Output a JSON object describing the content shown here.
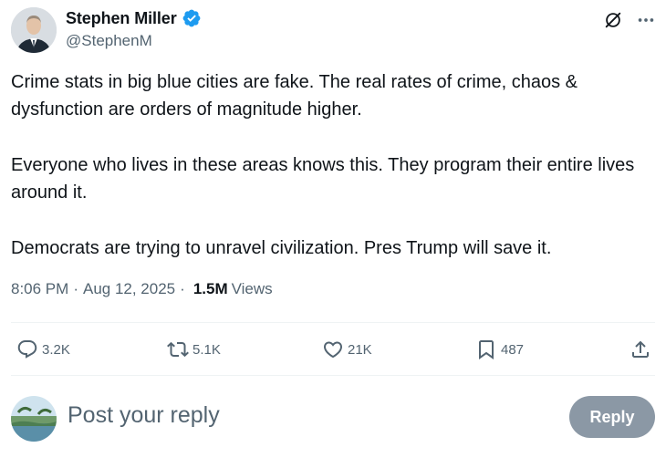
{
  "author": {
    "display_name": "Stephen Miller",
    "handle": "@StephenM",
    "verified": true
  },
  "header_icons": [
    "grok-icon",
    "more-icon"
  ],
  "tweet": {
    "paragraphs": [
      "Crime stats in big blue cities are fake. The real rates of crime, chaos & dysfunction are orders of magnitude higher.",
      "Everyone who lives in these areas knows this. They program their entire lives around it.",
      "Democrats are trying to unravel civilization. Pres Trump will save it."
    ]
  },
  "meta": {
    "time": "8:06 PM",
    "separator": "·",
    "date": "Aug 12, 2025",
    "views_count": "1.5M",
    "views_label": "Views"
  },
  "actions": {
    "replies": "3.2K",
    "reposts": "5.1K",
    "likes": "21K",
    "bookmarks": "487"
  },
  "composer": {
    "placeholder": "Post your reply",
    "button_label": "Reply"
  },
  "colors": {
    "text": "#0f1419",
    "secondary": "#536471",
    "verified": "#1d9bf0",
    "reply_button_disabled": "#8b98a5",
    "divider": "#eff3f4"
  }
}
